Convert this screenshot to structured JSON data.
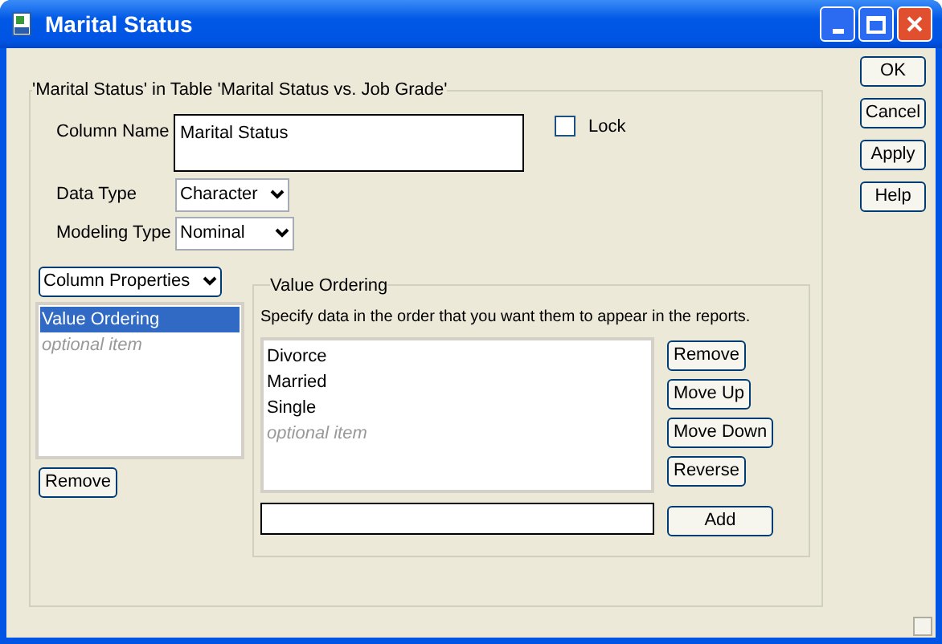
{
  "window": {
    "title": "Marital Status"
  },
  "group": {
    "title": "'Marital Status' in Table 'Marital Status vs. Job Grade'"
  },
  "column_name": {
    "label": "Column Name",
    "value": "Marital Status"
  },
  "lock": {
    "label": "Lock",
    "checked": false
  },
  "data_type": {
    "label": "Data Type",
    "value": "Character"
  },
  "modeling_type": {
    "label": "Modeling Type",
    "value": "Nominal"
  },
  "properties_menu": {
    "value": "Column Properties"
  },
  "property_list": [
    {
      "label": "Value Ordering",
      "selected": true,
      "kind": "item"
    },
    {
      "label": "optional item",
      "selected": false,
      "kind": "placeholder"
    }
  ],
  "remove_button": "Remove",
  "value_ordering": {
    "title": "Value Ordering",
    "instructions": "Specify data in the order that you want them to appear in the reports.",
    "values": [
      {
        "label": "Divorce",
        "kind": "item"
      },
      {
        "label": "Married",
        "kind": "item"
      },
      {
        "label": "Single",
        "kind": "item"
      },
      {
        "label": "optional item",
        "kind": "placeholder"
      }
    ],
    "buttons": [
      "Remove",
      "Move Up",
      "Move Down",
      "Reverse"
    ],
    "add_button": "Add"
  },
  "dialog_buttons": [
    "OK",
    "Cancel",
    "Apply",
    "Help"
  ]
}
